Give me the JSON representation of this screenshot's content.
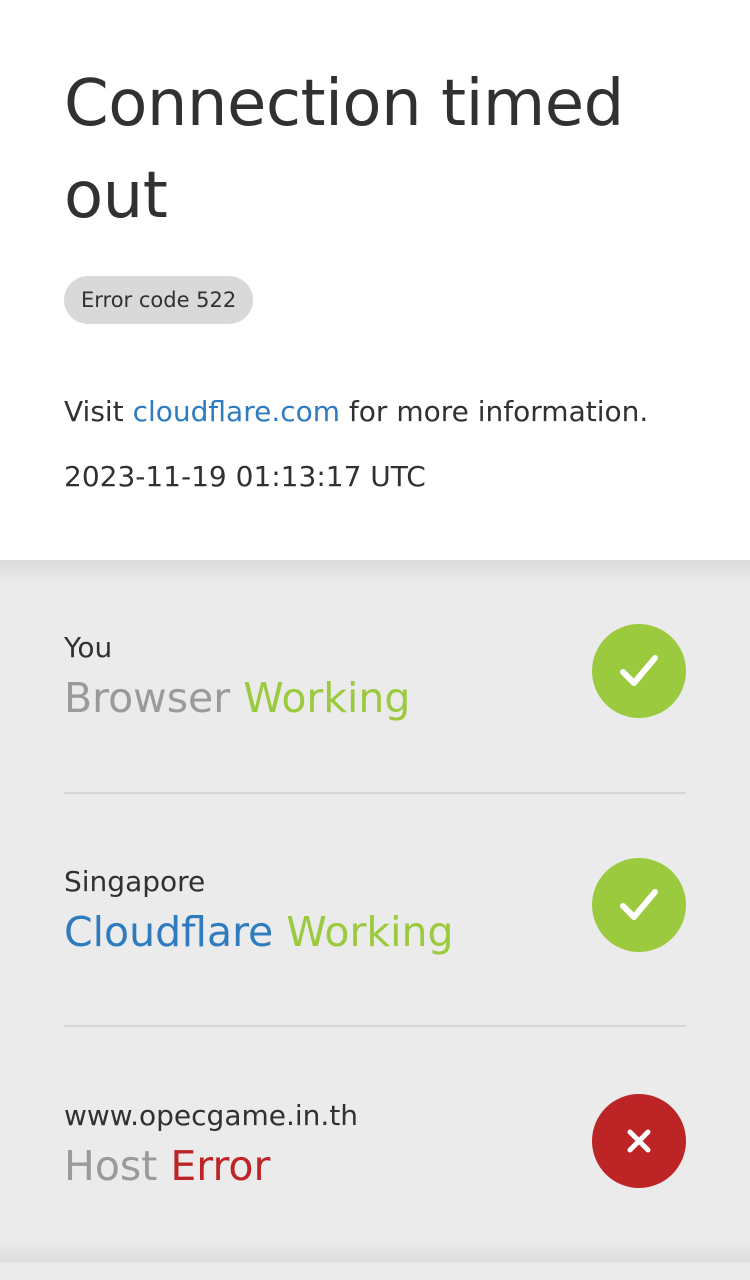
{
  "page": {
    "title": "Connection timed out",
    "error_code": "Error code 522",
    "visit_prefix": "Visit ",
    "visit_link": "cloudflare.com",
    "visit_suffix": " for more information.",
    "timestamp": "2023-11-19 01:13:17 UTC"
  },
  "status_items": [
    {
      "location": "You",
      "name": "Browser",
      "status": "Working",
      "icon": "checkmark-icon",
      "state": "ok"
    },
    {
      "location": "Singapore",
      "name": "Cloudflare",
      "status": "Working",
      "icon": "checkmark-icon",
      "state": "ok"
    },
    {
      "location": "www.opecgame.in.th",
      "name": "Host",
      "status": "Error",
      "icon": "close-icon",
      "state": "error"
    }
  ],
  "colors": {
    "working": "#9bca3e",
    "error": "#bd2426",
    "link": "#2f7bbf",
    "text": "#313131",
    "muted": "#9a9a9a",
    "status_background": "#ebebeb"
  }
}
